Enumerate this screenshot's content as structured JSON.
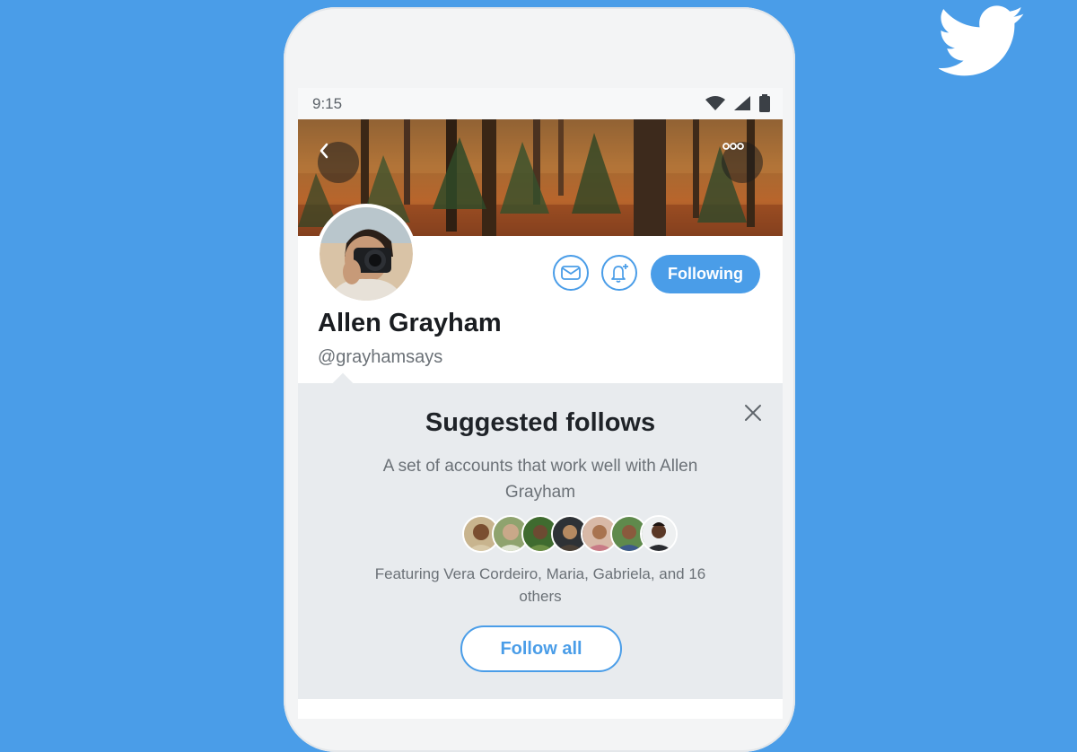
{
  "colors": {
    "background": "#4a9de8",
    "accent": "#4a9de8"
  },
  "icons": {
    "brand": "twitter-bird-icon",
    "back": "chevron-left-icon",
    "more": "more-dots-icon",
    "message": "envelope-icon",
    "notify": "bell-plus-icon",
    "close": "close-icon",
    "status": [
      "wifi-icon",
      "signal-icon",
      "battery-icon"
    ]
  },
  "status_bar": {
    "time": "9:15"
  },
  "profile": {
    "name": "Allen Grayham",
    "handle": "@grayhamsays",
    "following_label": "Following"
  },
  "suggested": {
    "title": "Suggested follows",
    "subtitle": "A set of accounts that work well with Allen Grayham",
    "featuring": "Featuring Vera Cordeiro, Maria, Gabriela, and 16 others",
    "follow_all_label": "Follow all",
    "avatar_count": 7
  }
}
